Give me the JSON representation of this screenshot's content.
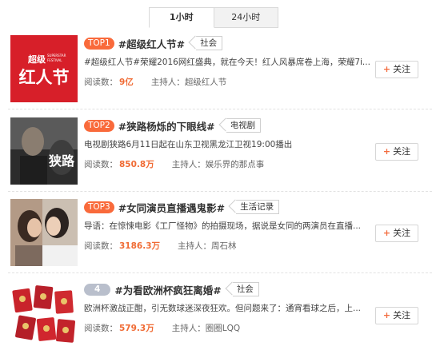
{
  "tabs": [
    {
      "label": "1小时",
      "active": true
    },
    {
      "label": "24小时",
      "active": false
    }
  ],
  "items": [
    {
      "rank": "TOP1",
      "topic": "#超级红人节#",
      "tag": "社会",
      "desc": "#超级红人节#荣耀2016网红盛典，就在今天！红人风暴席卷上海，荣耀7i...",
      "reads_label": "阅读数：",
      "reads": "9亿",
      "host_label": "主持人：",
      "host": "超级红人节",
      "follow": "关注",
      "thumb_icon": "superstar-festival-logo",
      "thumb_text": {
        "top": "超级",
        "main": "红人节",
        "sub": "SUPERSTAR FESTIVAL"
      }
    },
    {
      "rank": "TOP2",
      "topic": "#狭路杨烁的下眼线#",
      "tag": "电视剧",
      "desc": "电视剧狭路6月11日起在山东卫视黑龙江卫视19:00播出",
      "reads_label": "阅读数：",
      "reads": "850.8万",
      "host_label": "主持人：",
      "host": "娱乐界的那点事",
      "follow": "关注",
      "thumb_icon": "drama-poster",
      "thumb_text": {
        "main": "狭路"
      }
    },
    {
      "rank": "TOP3",
      "topic": "#女同演员直播遇鬼影#",
      "tag": "生活记录",
      "desc": "导语：在惊悚电影《工厂怪物》的拍摄现场，据说是女同的两演员在直播...",
      "reads_label": "阅读数：",
      "reads": "3186.3万",
      "host_label": "主持人：",
      "host": "周石林",
      "follow": "关注",
      "thumb_icon": "two-actresses-photo"
    },
    {
      "rank": "4",
      "topic": "#为看欧洲杯疯狂离婚#",
      "tag": "社会",
      "desc": "欧洲杯激战正酣，引无数球迷深夜狂欢。但问题来了：通宵看球之后，上...",
      "reads_label": "阅读数：",
      "reads": "579.3万",
      "host_label": "主持人：",
      "host": "圈圈LQQ",
      "follow": "关注",
      "thumb_icon": "marriage-certificates-photo"
    }
  ],
  "colors": {
    "accent": "#f96a3b",
    "rank_grey": "#b9bfcc",
    "count": "#f06b34",
    "thumb_red": "#d71f29"
  }
}
